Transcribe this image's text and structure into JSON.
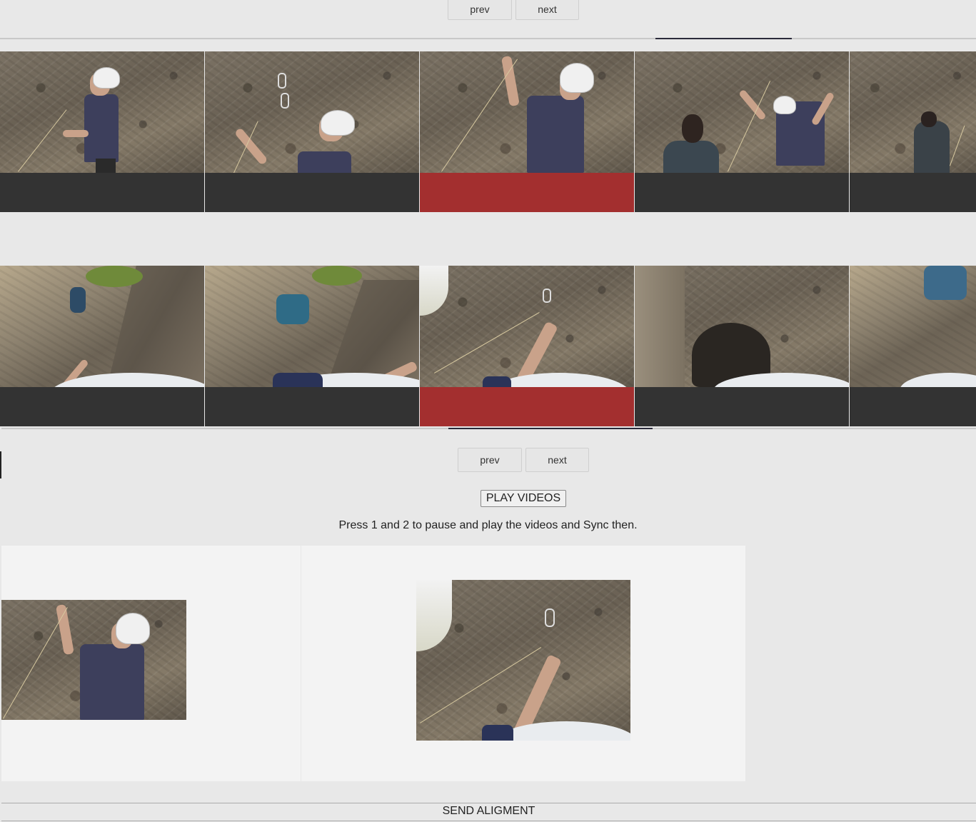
{
  "top_nav": {
    "prev_label": "prev",
    "next_label": "next"
  },
  "strip1": {
    "frames": [
      {
        "label": "camera-1-frame-1",
        "selected": false
      },
      {
        "label": "camera-1-frame-2",
        "selected": false
      },
      {
        "label": "camera-1-frame-3",
        "selected": true
      },
      {
        "label": "camera-1-frame-4",
        "selected": false
      },
      {
        "label": "camera-1-frame-5",
        "selected": false
      }
    ]
  },
  "strip2": {
    "frames": [
      {
        "label": "camera-2-frame-1",
        "selected": false
      },
      {
        "label": "camera-2-frame-2",
        "selected": false
      },
      {
        "label": "camera-2-frame-3",
        "selected": true
      },
      {
        "label": "camera-2-frame-4",
        "selected": false
      },
      {
        "label": "camera-2-frame-5",
        "selected": false
      }
    ]
  },
  "bottom_nav": {
    "prev_label": "prev",
    "next_label": "next"
  },
  "play_button": "PLAY VIDEOS",
  "instructions": "Press 1 and 2 to pause and play the videos and Sync then.",
  "send_button": "SEND ALIGMENT",
  "colors": {
    "selected_bar": "#a32f2f",
    "unselected_bar": "#333333",
    "background": "#e8e8e8"
  }
}
